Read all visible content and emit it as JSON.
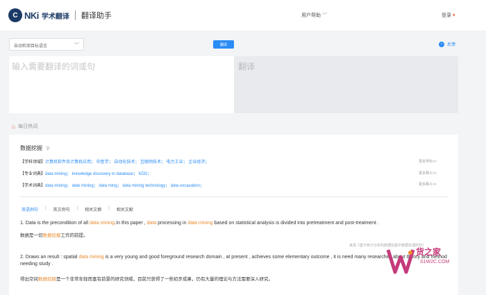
{
  "header": {
    "logo_mark": "C",
    "logo_brand": "NKi",
    "logo_sub": "学术翻译",
    "tool_name": "翻译助手",
    "nav_help": "用户帮助",
    "nav_login": "登录"
  },
  "controls": {
    "lang_select": "自动检测目标语言",
    "translate_button": "翻译",
    "feedback": "反馈"
  },
  "input": {
    "placeholder": "输入需要翻译的词或句"
  },
  "output": {
    "placeholder": "翻译"
  },
  "hot": {
    "title": "每日热词"
  },
  "entry": {
    "term": "数据挖掘",
    "rows": [
      {
        "tag": "【学科领域】",
        "items": "计算机软件及计算机应用； 中医学； 自动化技术； 互联网技术； 电力工业； 企业经济；",
        "more": "更多学科>>"
      },
      {
        "tag": "【专业词典】",
        "items": "data mining； knowledge discovery in database； KDD；",
        "more": "更多释义>>"
      },
      {
        "tag": "【学术词典】",
        "items": "data mining； date mining； data ming； data mining technology； data excavation；",
        "more": "更多释义>>"
      }
    ],
    "tabs": [
      "双语例句",
      "英文例句",
      "相关文摘",
      "相关文献"
    ],
    "examples": [
      {
        "en_parts": [
          "1. Data is the precondition of all ",
          "data mining",
          ".In this paper , ",
          "data",
          " processing in ",
          "data mining",
          " based on statistical analysis is divided into pretreatment and post-treatment ."
        ],
        "zh_parts": [
          "数据是一切",
          "数据挖掘",
          "工作的前提。"
        ],
        "source": "来源《基于统计分析的数据挖掘中数据处理研究》"
      },
      {
        "en_parts": [
          "2. Draws an result : spatial ",
          "data mining",
          " is a very young and good foreground research domain , at present , achieves some elementary outcome , it is need many researches",
          " about theory and method needing study ."
        ],
        "zh_parts": [
          "得出空间",
          "数据挖掘",
          "是一个非常年轻而富有前景的研究领域，目前只获得了一些初步成果，仍有大量的理论与方法需要深入研究。"
        ]
      }
    ]
  },
  "watermark": {
    "main": "货之家",
    "sub": "S1W2C.COM"
  }
}
